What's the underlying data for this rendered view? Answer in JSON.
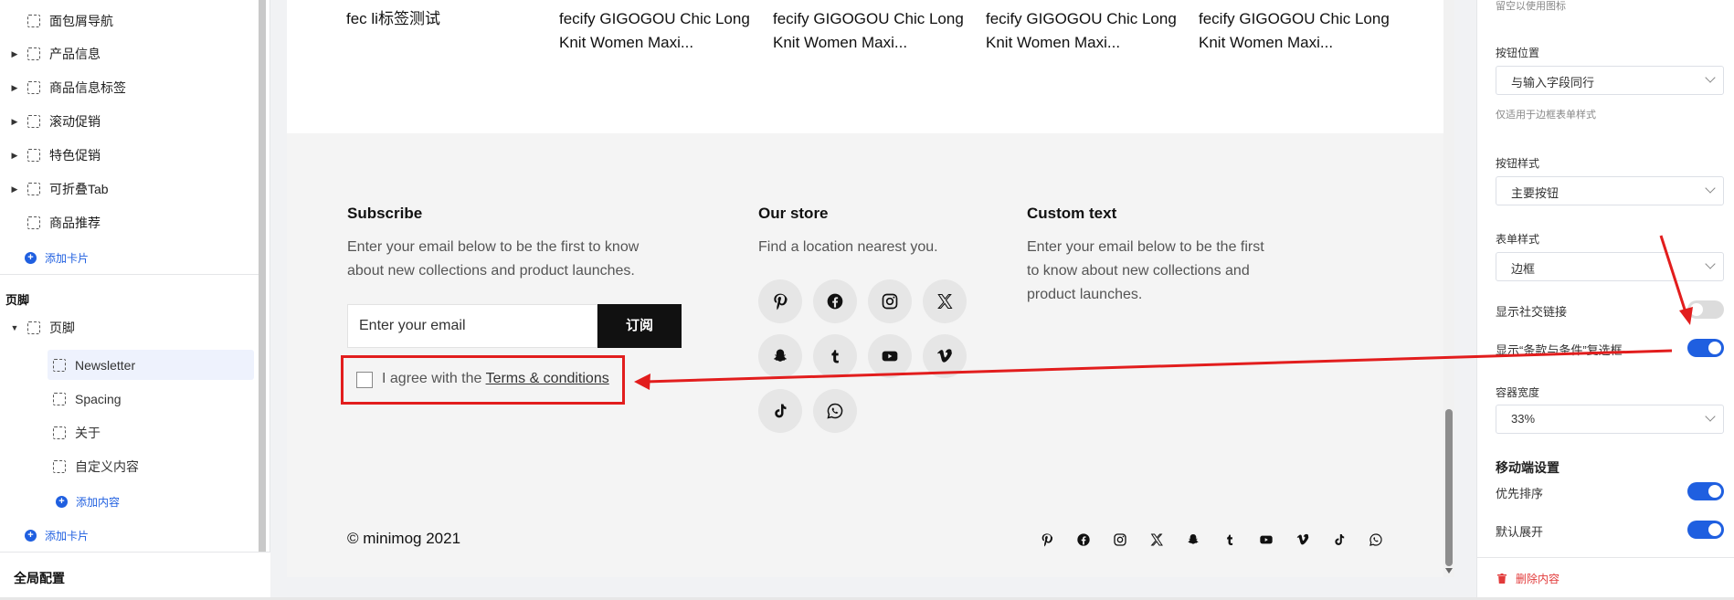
{
  "sidebar": {
    "tree": [
      {
        "label": "面包屑导航",
        "has_caret": false
      },
      {
        "label": "产品信息",
        "has_caret": true
      },
      {
        "label": "商品信息标签",
        "has_caret": true
      },
      {
        "label": "滚动促销",
        "has_caret": true
      },
      {
        "label": "特色促销",
        "has_caret": true
      },
      {
        "label": "可折叠Tab",
        "has_caret": true
      },
      {
        "label": "商品推荐",
        "has_caret": false
      }
    ],
    "add_card_1": "添加卡片",
    "footer_section_title": "页脚",
    "footer_group": "页脚",
    "footer_children": [
      "Newsletter",
      "Spacing",
      "关于",
      "自定义内容"
    ],
    "add_content": "添加内容",
    "add_card_2": "添加卡片",
    "global_config": "全局配置"
  },
  "preview": {
    "products": [
      "fec li标签测试",
      "fecify GIGOGOU Chic Long Knit Women Maxi...",
      "fecify GIGOGOU Chic Long Knit Women Maxi...",
      "fecify GIGOGOU Chic Long Knit Women Maxi...",
      "fecify GIGOGOU Chic Long Knit Women Maxi..."
    ],
    "subscribe": {
      "title": "Subscribe",
      "text": "Enter your email below to be the first to know about new collections and product launches.",
      "email_placeholder": "Enter your email",
      "button": "订阅",
      "agree_prefix": "I agree with the ",
      "agree_link": "Terms & conditions"
    },
    "store": {
      "title": "Our store",
      "text": "Find a location nearest you.",
      "socials": [
        "pinterest-icon",
        "facebook-icon",
        "instagram-icon",
        "x-icon",
        "snapchat-icon",
        "tumblr-icon",
        "youtube-icon",
        "vimeo-icon",
        "tiktok-icon",
        "whatsapp-icon"
      ]
    },
    "custom": {
      "title": "Custom text",
      "text": "Enter your email below to be the first to know about new collections and product launches."
    },
    "copyright": "© minimog 2021"
  },
  "panel": {
    "top_hint": "留空以使用图标",
    "button_position_label": "按钮位置",
    "button_position_value": "与输入字段同行",
    "button_position_hint": "仅适用于边框表单样式",
    "button_style_label": "按钮样式",
    "button_style_value": "主要按钮",
    "form_style_label": "表单样式",
    "form_style_value": "边框",
    "show_social_label": "显示社交链接",
    "show_social_on": false,
    "show_terms_label": "显示“条款与条件”复选框",
    "show_terms_on": true,
    "container_width_label": "容器宽度",
    "container_width_value": "33%",
    "mobile_section": "移动端设置",
    "priority_label": "优先排序",
    "priority_on": true,
    "expand_label": "默认展开",
    "expand_on": true,
    "delete_label": "删除内容"
  },
  "colors": {
    "accent": "#1f5fe0",
    "highlight": "#e21d1d",
    "dark_button": "#111111"
  }
}
